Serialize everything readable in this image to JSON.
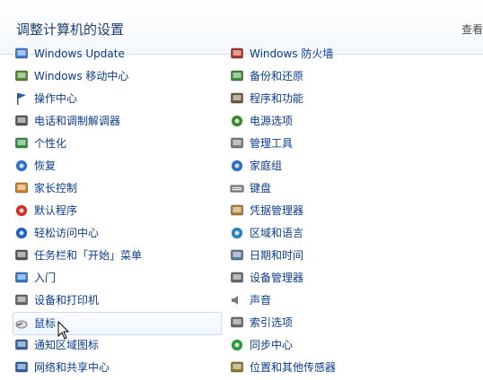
{
  "header": {
    "title": "调整计算机的设置",
    "view_by": "查看"
  },
  "left_items": [
    {
      "label": "Windows Update",
      "icon": "windows-update-icon",
      "color": "#3a7bd5"
    },
    {
      "label": "Windows 移动中心",
      "icon": "mobility-center-icon",
      "color": "#4a8a2a"
    },
    {
      "label": "操作中心",
      "icon": "action-center-flag-icon",
      "color": "#1f5fc2"
    },
    {
      "label": "电话和调制解调器",
      "icon": "phone-modem-icon",
      "color": "#555555"
    },
    {
      "label": "个性化",
      "icon": "personalization-icon",
      "color": "#2f8f3f"
    },
    {
      "label": "恢复",
      "icon": "recovery-icon",
      "color": "#2c70c9"
    },
    {
      "label": "家长控制",
      "icon": "parental-controls-icon",
      "color": "#d08020"
    },
    {
      "label": "默认程序",
      "icon": "default-programs-icon",
      "color": "#d03020"
    },
    {
      "label": "轻松访问中心",
      "icon": "ease-of-access-icon",
      "color": "#2060c0"
    },
    {
      "label": "任务栏和「开始」菜单",
      "icon": "taskbar-start-menu-icon",
      "color": "#555555"
    },
    {
      "label": "入门",
      "icon": "getting-started-icon",
      "color": "#2a7ad0"
    },
    {
      "label": "设备和打印机",
      "icon": "devices-printers-icon",
      "color": "#666666"
    },
    {
      "label": "鼠标",
      "icon": "mouse-icon",
      "color": "#777777"
    },
    {
      "label": "通知区域图标",
      "icon": "notification-area-icon",
      "color": "#3060a0"
    },
    {
      "label": "网络和共享中心",
      "icon": "network-sharing-icon",
      "color": "#2a5fa0"
    }
  ],
  "right_items": [
    {
      "label": "Windows 防火墙",
      "icon": "firewall-icon",
      "color": "#b03020"
    },
    {
      "label": "备份和还原",
      "icon": "backup-restore-icon",
      "color": "#3a8a3a"
    },
    {
      "label": "程序和功能",
      "icon": "programs-features-icon",
      "color": "#6a5a3a"
    },
    {
      "label": "电源选项",
      "icon": "power-options-icon",
      "color": "#3a8a2a"
    },
    {
      "label": "管理工具",
      "icon": "admin-tools-icon",
      "color": "#7a7a7a"
    },
    {
      "label": "家庭组",
      "icon": "homegroup-icon",
      "color": "#2a70c0"
    },
    {
      "label": "键盘",
      "icon": "keyboard-icon",
      "color": "#777777"
    },
    {
      "label": "凭据管理器",
      "icon": "credential-manager-icon",
      "color": "#b08030"
    },
    {
      "label": "区域和语言",
      "icon": "region-language-icon",
      "color": "#2a80c0"
    },
    {
      "label": "日期和时间",
      "icon": "date-time-icon",
      "color": "#5a7a9a"
    },
    {
      "label": "设备管理器",
      "icon": "device-manager-icon",
      "color": "#666666"
    },
    {
      "label": "声音",
      "icon": "sound-icon",
      "color": "#777777"
    },
    {
      "label": "索引选项",
      "icon": "indexing-options-icon",
      "color": "#6a6a6a"
    },
    {
      "label": "同步中心",
      "icon": "sync-center-icon",
      "color": "#2a9a3a"
    },
    {
      "label": "位置和其他传感器",
      "icon": "location-sensors-icon",
      "color": "#8a7a2a"
    }
  ],
  "hovered_item": "鼠标"
}
